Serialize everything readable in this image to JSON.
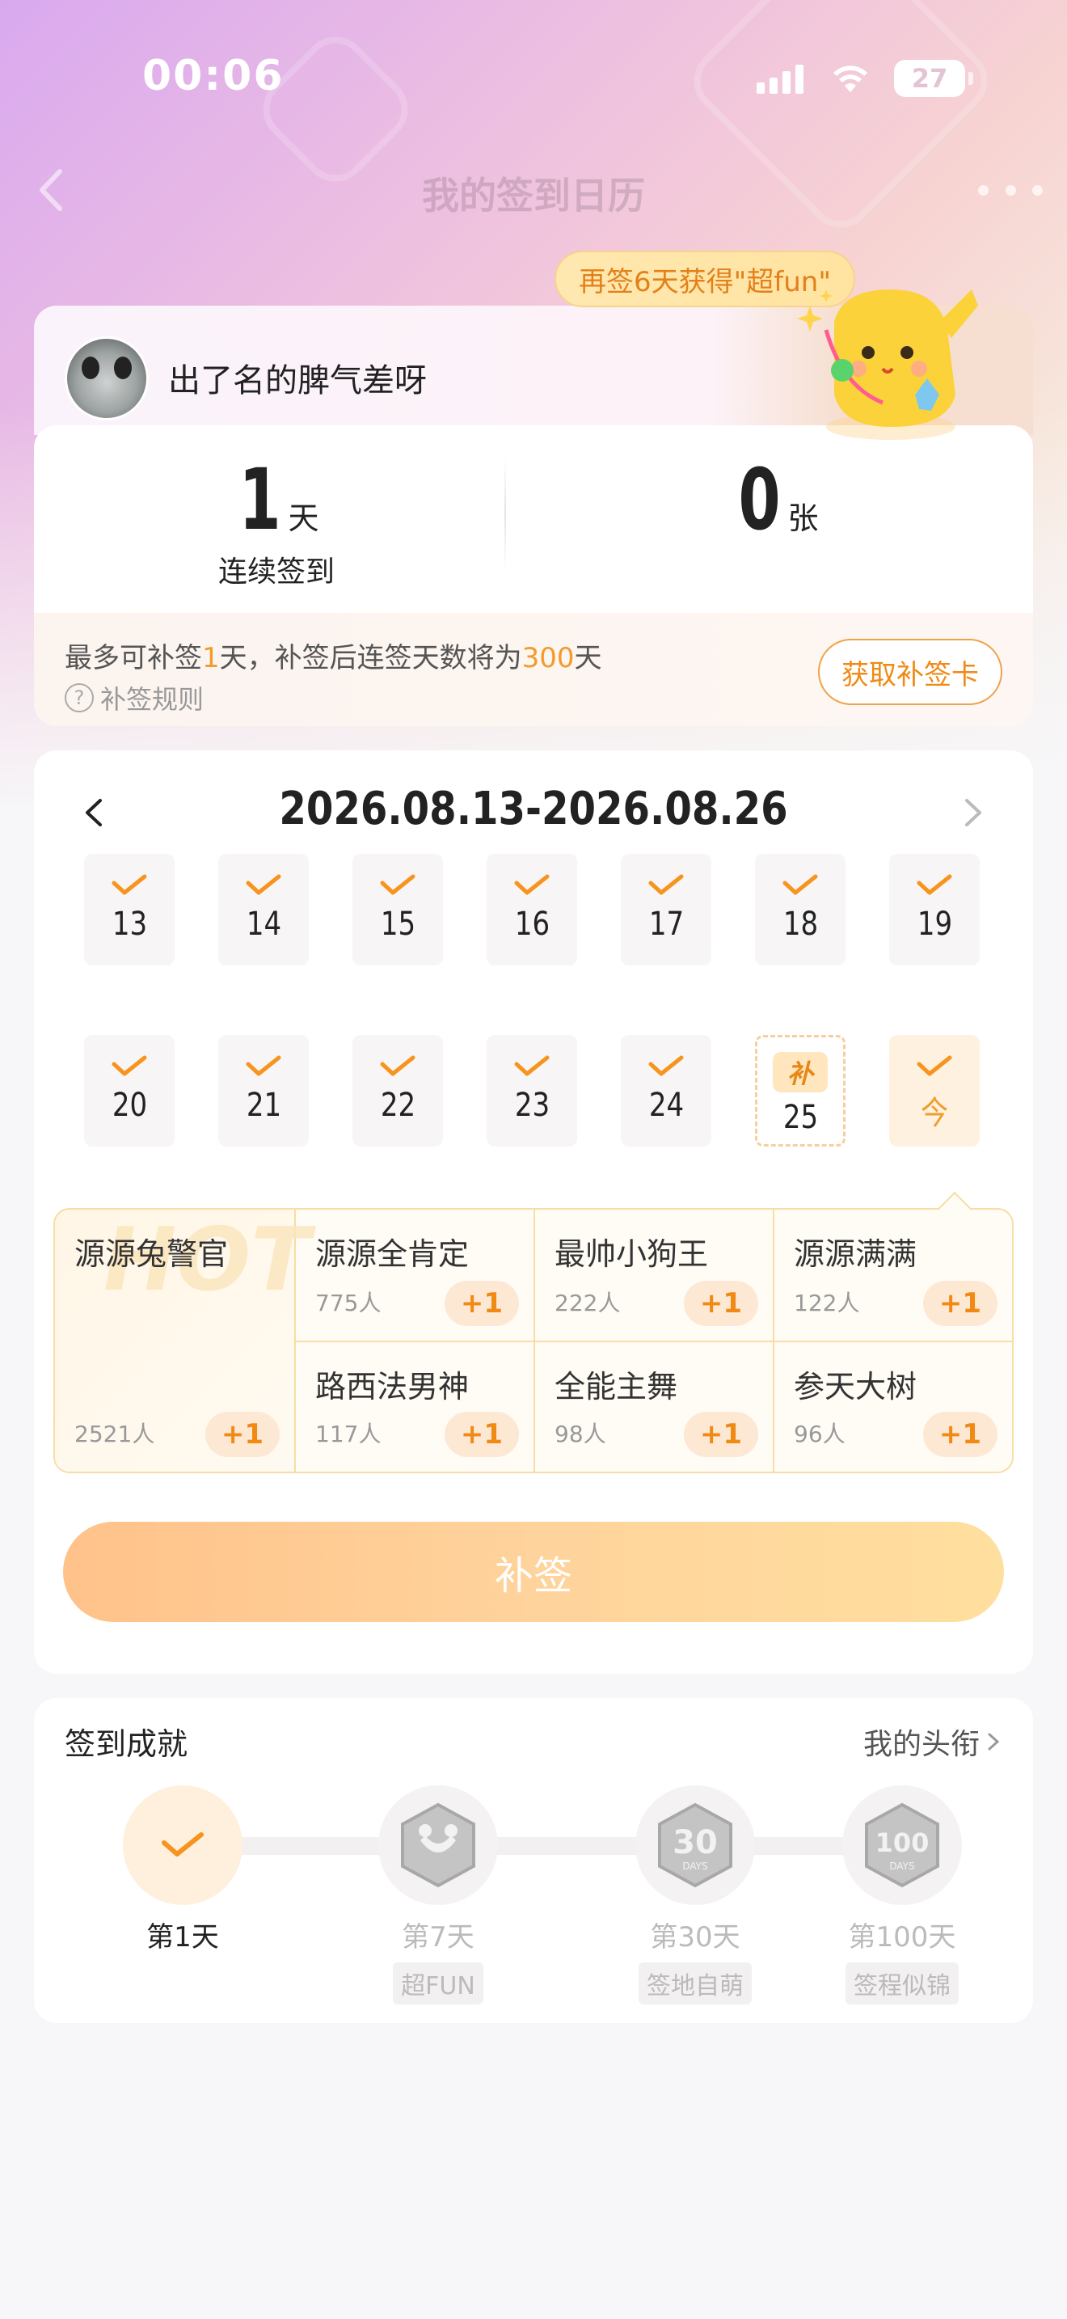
{
  "status_bar": {
    "time": "00:06",
    "battery": "27"
  },
  "nav": {
    "title": "我的签到日历"
  },
  "profile": {
    "username": "出了名的脾气差呀",
    "bonus_bubble": "再签6天获得\"超fun\"",
    "streak_value": "1",
    "streak_unit": "天",
    "streak_label": "连续签到",
    "cards_value": "0",
    "cards_unit": "张",
    "makeup_prefix": "最多可补签",
    "makeup_days": "1",
    "makeup_mid": "天，补签后连签天数将为",
    "makeup_total": "300",
    "makeup_suffix": "天",
    "rules_label": "补签规则",
    "get_card_label": "获取补签卡"
  },
  "calendar": {
    "range": "2026.08.13-2026.08.26",
    "days": [
      {
        "num": "13",
        "state": "checked"
      },
      {
        "num": "14",
        "state": "checked"
      },
      {
        "num": "15",
        "state": "checked"
      },
      {
        "num": "16",
        "state": "checked"
      },
      {
        "num": "17",
        "state": "checked"
      },
      {
        "num": "18",
        "state": "checked"
      },
      {
        "num": "19",
        "state": "checked"
      },
      {
        "num": "20",
        "state": "checked"
      },
      {
        "num": "21",
        "state": "checked"
      },
      {
        "num": "22",
        "state": "checked"
      },
      {
        "num": "23",
        "state": "checked"
      },
      {
        "num": "24",
        "state": "checked"
      },
      {
        "num": "25",
        "state": "makeup",
        "tag": "补"
      },
      {
        "num": "今",
        "state": "today"
      }
    ],
    "hot_watermark": "HOT",
    "titles": [
      {
        "name": "源源兔警官",
        "count": "2521人",
        "plus": "+1"
      },
      {
        "name": "源源全肯定",
        "count": "775人",
        "plus": "+1"
      },
      {
        "name": "最帅小狗王",
        "count": "222人",
        "plus": "+1"
      },
      {
        "name": "源源满满",
        "count": "122人",
        "plus": "+1"
      },
      {
        "name": "路西法男神",
        "count": "117人",
        "plus": "+1"
      },
      {
        "name": "全能主舞",
        "count": "98人",
        "plus": "+1"
      },
      {
        "name": "参天大树",
        "count": "96人",
        "plus": "+1"
      }
    ],
    "makeup_button": "补签"
  },
  "achievements": {
    "title": "签到成就",
    "link": "我的头衔",
    "items": [
      {
        "day": "第1天",
        "name": ""
      },
      {
        "day": "第7天",
        "name": "超FUN"
      },
      {
        "day": "第30天",
        "name": "签地自萌"
      },
      {
        "day": "第100天",
        "name": "签程似锦"
      }
    ]
  },
  "colors": {
    "accent": "#f19c2c",
    "checked": "#f7941d"
  }
}
